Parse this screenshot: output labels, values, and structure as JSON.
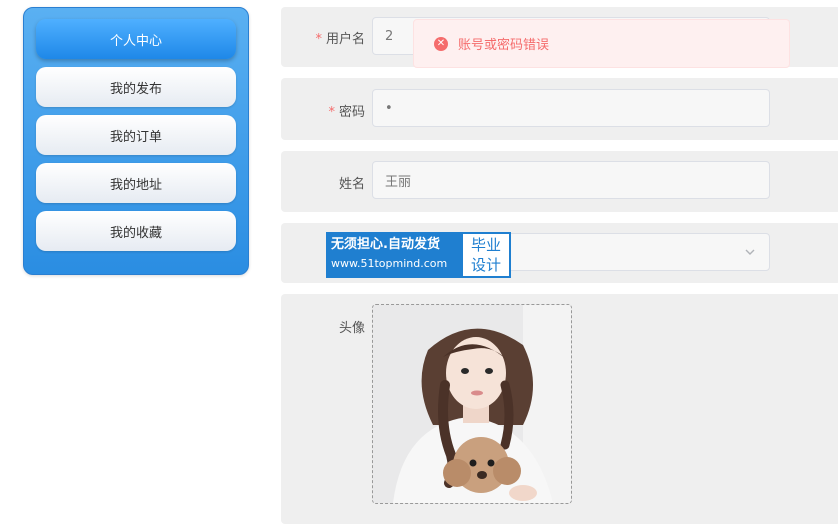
{
  "sidebar": {
    "items": [
      {
        "label": "个人中心",
        "active": true
      },
      {
        "label": "我的发布",
        "active": false
      },
      {
        "label": "我的订单",
        "active": false
      },
      {
        "label": "我的地址",
        "active": false
      },
      {
        "label": "我的收藏",
        "active": false
      }
    ]
  },
  "form": {
    "username": {
      "label": "用户名",
      "required": "*",
      "value": "2"
    },
    "password": {
      "label": "密码",
      "required": "*",
      "value": "•"
    },
    "name": {
      "label": "姓名",
      "value": "王丽"
    },
    "avatar": {
      "label": "头像"
    }
  },
  "toast": {
    "message": "账号或密码错误",
    "type": "error"
  },
  "watermark": {
    "line1": "无须担心.自动发货",
    "line2": "www.51topmind.com",
    "badge_top": "毕业",
    "badge_bottom": "设计"
  },
  "colors": {
    "accent": "#2a8de2",
    "error": "#f56c6c",
    "row_bg": "#efefef"
  }
}
